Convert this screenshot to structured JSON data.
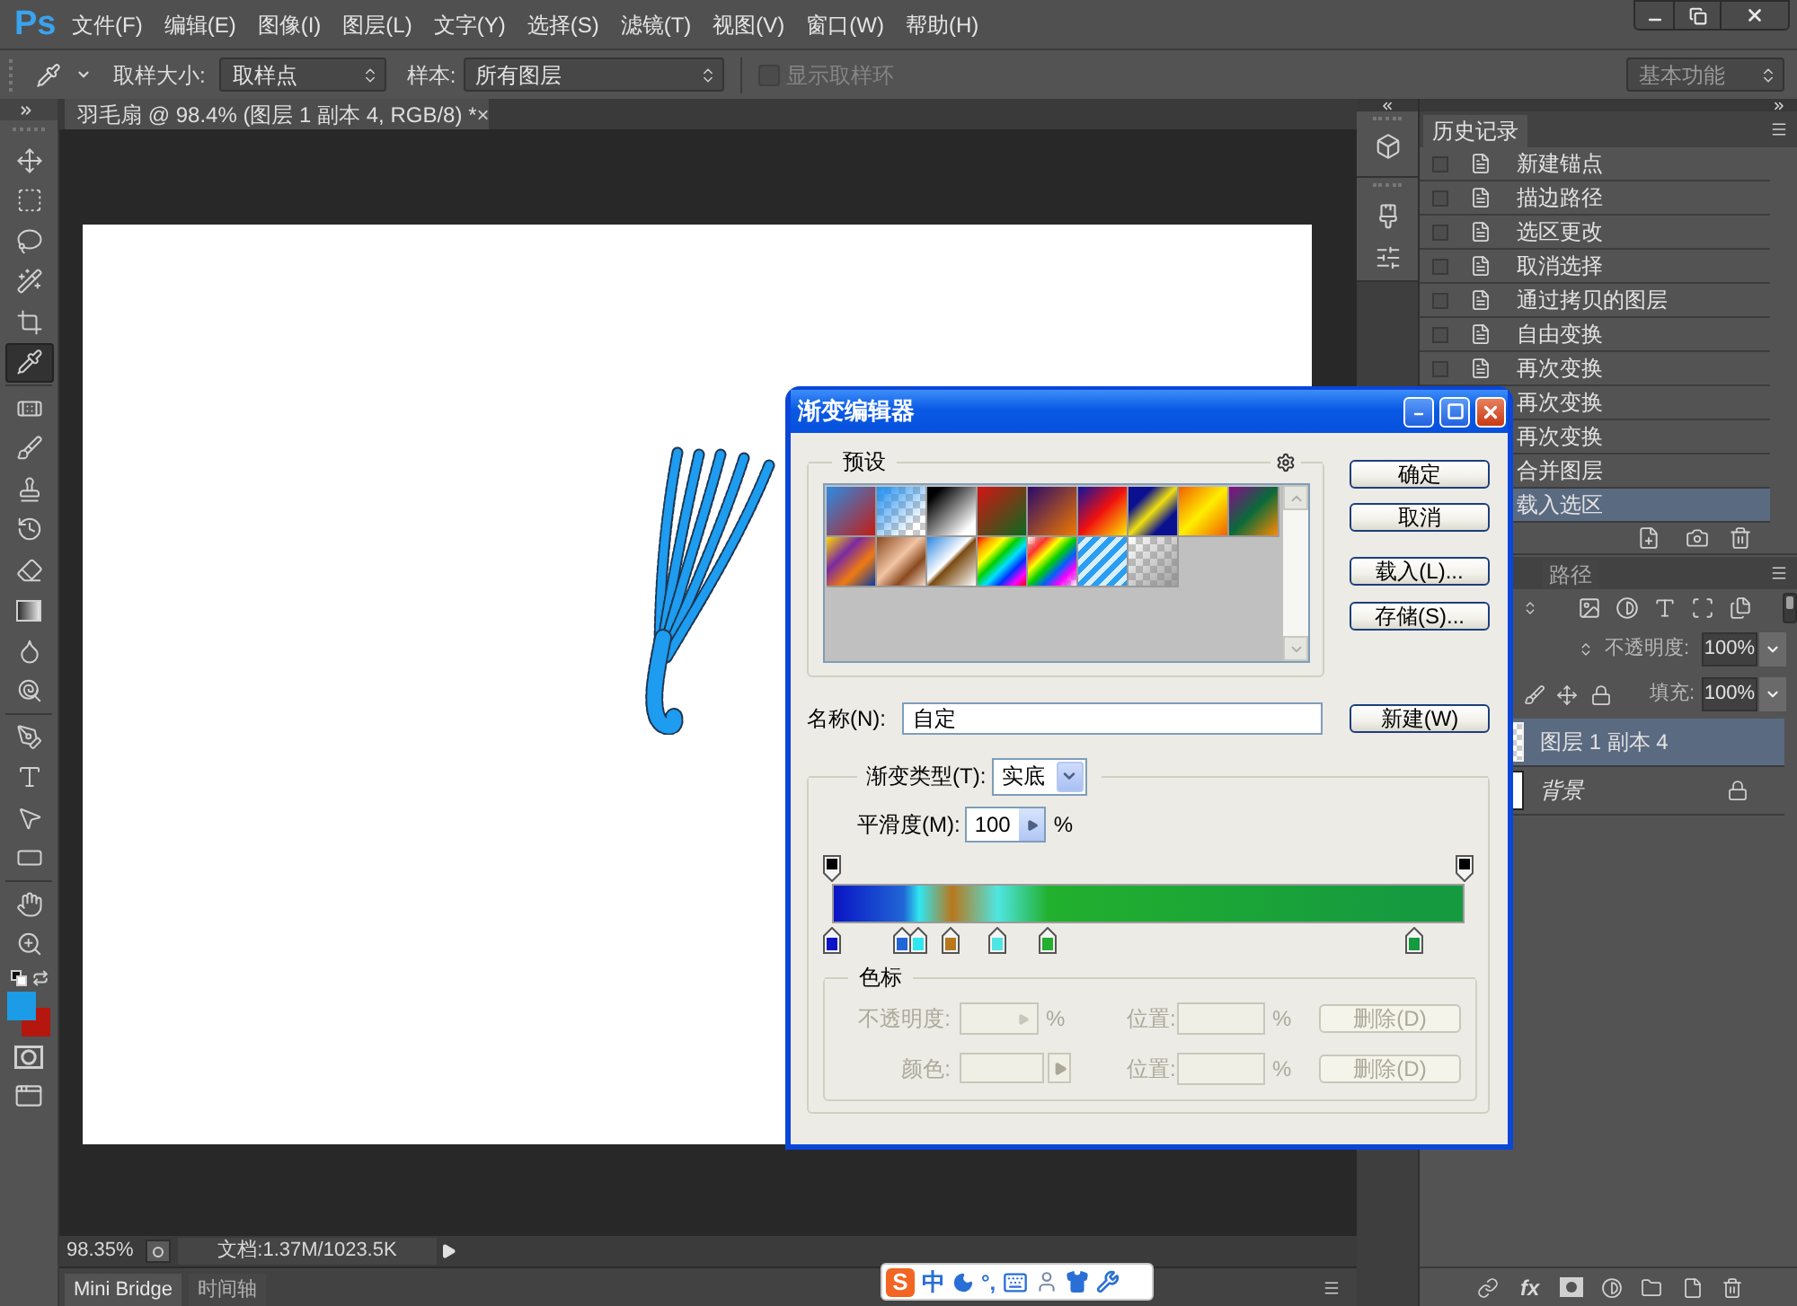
{
  "menu_bar": {
    "logo": "Ps",
    "items": [
      "文件(F)",
      "编辑(E)",
      "图像(I)",
      "图层(L)",
      "文字(Y)",
      "选择(S)",
      "滤镜(T)",
      "视图(V)",
      "窗口(W)",
      "帮助(H)"
    ]
  },
  "options_bar": {
    "sample_size_label": "取样大小:",
    "sample_size": "取样点",
    "sample_label": "样本:",
    "sample": "所有图层",
    "sample_ring": {
      "label": "显示取样环",
      "checked": false,
      "disabled": true
    },
    "workspace": "基本功能"
  },
  "tools": [
    {
      "kind": "move",
      "selected": false
    },
    {
      "kind": "marquee",
      "selected": false
    },
    {
      "kind": "lasso",
      "selected": false
    },
    {
      "kind": "quickselect",
      "selected": false
    },
    {
      "kind": "crop",
      "selected": false
    },
    {
      "kind": "eyedropper",
      "selected": true
    },
    {
      "kind": "healing",
      "selected": false
    },
    {
      "kind": "brush",
      "selected": false
    },
    {
      "kind": "stamp",
      "selected": false
    },
    {
      "kind": "historybrush",
      "selected": false
    },
    {
      "kind": "eraser",
      "selected": false
    },
    {
      "kind": "gradient",
      "selected": false
    },
    {
      "kind": "blur",
      "selected": false
    },
    {
      "kind": "dodge",
      "selected": false
    },
    {
      "kind": "pen",
      "selected": false
    },
    {
      "kind": "type",
      "selected": false
    },
    {
      "kind": "pathselect",
      "selected": false
    },
    {
      "kind": "shape",
      "selected": false
    },
    {
      "kind": "hand",
      "selected": false
    },
    {
      "kind": "zoom",
      "selected": false
    }
  ],
  "colors": [
    {
      "kind": "foreground",
      "color": "#1c9be6"
    },
    {
      "kind": "background",
      "color": "#b5170f"
    }
  ],
  "document_tab": {
    "title": "羽毛扇 @ 98.4% (图层 1 副本 4, RGB/8) *",
    "close": "×"
  },
  "status_bar": {
    "zoom": "98.35%",
    "document_info": "文档:1.37M/1023.5K"
  },
  "bottom_tabs": [
    {
      "label": "Mini Bridge",
      "selected": true
    },
    {
      "label": "时间轴",
      "selected": false
    }
  ],
  "history_panel": {
    "title": "历史记录",
    "items": [
      {
        "label": "新建锚点",
        "selected": false
      },
      {
        "label": "描边路径",
        "selected": false
      },
      {
        "label": "选区更改",
        "selected": false
      },
      {
        "label": "取消选择",
        "selected": false
      },
      {
        "label": "通过拷贝的图层",
        "selected": false
      },
      {
        "label": "自由变换",
        "selected": false
      },
      {
        "label": "再次变换",
        "selected": false
      },
      {
        "label": "再次变换",
        "selected": false
      },
      {
        "label": "再次变换",
        "selected": false
      },
      {
        "label": "合并图层",
        "selected": false
      },
      {
        "label": "载入选区",
        "selected": true
      }
    ]
  },
  "layers_panel": {
    "tabs": [
      {
        "label": "路径",
        "selected": false
      }
    ],
    "opacity_label": "不透明度:",
    "opacity": "100%",
    "fill_label": "填充:",
    "fill": "100%",
    "layers": [
      {
        "name": "图层 1 副本 4",
        "kind": "layer",
        "selected": true
      },
      {
        "name": "背景",
        "kind": "background",
        "selected": false
      }
    ],
    "style_button": "fx"
  },
  "gradient_editor": {
    "title": "渐变编辑器",
    "presets_label": "预设",
    "buttons": [
      "确定",
      "取消",
      "载入(L)...",
      "存储(S)..."
    ],
    "name_label": "名称(N):",
    "name": "自定",
    "new_button": "新建(W)",
    "type_label": "渐变类型(T):",
    "type": "实底",
    "smoothness_label": "平滑度(M):",
    "smoothness": "100",
    "smoothness_unit": "%",
    "color_stops": [
      {
        "color": "#0a14c4"
      },
      {
        "color": "#2066d6"
      },
      {
        "color": "#30e6f0"
      },
      {
        "color": "#b8781e"
      },
      {
        "color": "#4ee6e2"
      },
      {
        "color": "#22b02e"
      },
      {
        "color": "#159a40"
      }
    ],
    "stops_group": {
      "label": "色标",
      "rows": [
        {
          "kind": "opacity",
          "label": "不透明度:",
          "unit": "%",
          "location_label": "位置:",
          "location_unit": "%",
          "delete_button": "删除(D)",
          "disabled": true
        },
        {
          "kind": "color",
          "label": "颜色:",
          "location_label": "位置:",
          "location_unit": "%",
          "delete_button": "删除(D)",
          "disabled": true
        }
      ]
    }
  },
  "ime_toolbar": {
    "logo": "S",
    "mode": "中",
    "punctuation": "°,"
  }
}
